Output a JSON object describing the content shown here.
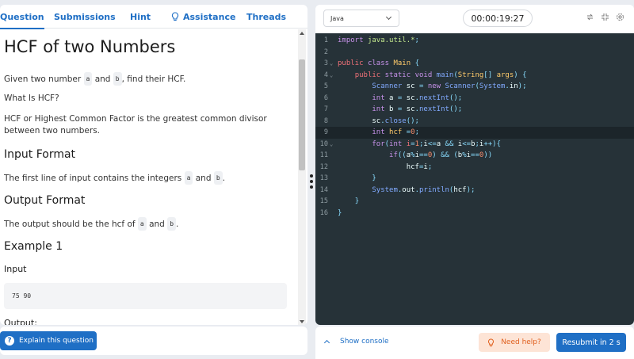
{
  "tabs": {
    "question": "Question",
    "submissions": "Submissions",
    "hint": "Hint",
    "assistance": "Assistance",
    "threads": "Threads"
  },
  "question": {
    "title": "HCF of two Numbers",
    "given_pre": "Given two number",
    "given_mid": "and",
    "given_post": ", find their HCF.",
    "var_a": "a",
    "var_b": "b",
    "what_is": "What Is HCF?",
    "definition": "HCF or Highest Common Factor is the greatest common divisor between two numbers.",
    "input_format_title": "Input Format",
    "input_format_pre": "The first line of input contains the integers",
    "input_format_mid": "and",
    "input_format_post": ".",
    "output_format_title": "Output Format",
    "output_format_pre": "The output should be the hcf of",
    "output_format_mid": "and",
    "output_format_post": ".",
    "example_title": "Example 1",
    "input_label": "Input",
    "input_value": "75 90",
    "output_label": "Output:"
  },
  "explain_button": "Explain this question",
  "editor": {
    "language": "Java",
    "timer": "00:00:19:27",
    "line_numbers": [
      "1",
      "2",
      "3",
      "4",
      "5",
      "6",
      "7",
      "8",
      "9",
      "10",
      "11",
      "12",
      "13",
      "14",
      "15",
      "16"
    ]
  },
  "footer": {
    "show_console": "Show console",
    "need_help": "Need help?",
    "resubmit": "Resubmit in 2 s"
  },
  "colors": {
    "accent": "#1f6fc5",
    "editor_bg": "#263238",
    "help_bg": "#fde4d6",
    "help_text": "#e0601f"
  }
}
